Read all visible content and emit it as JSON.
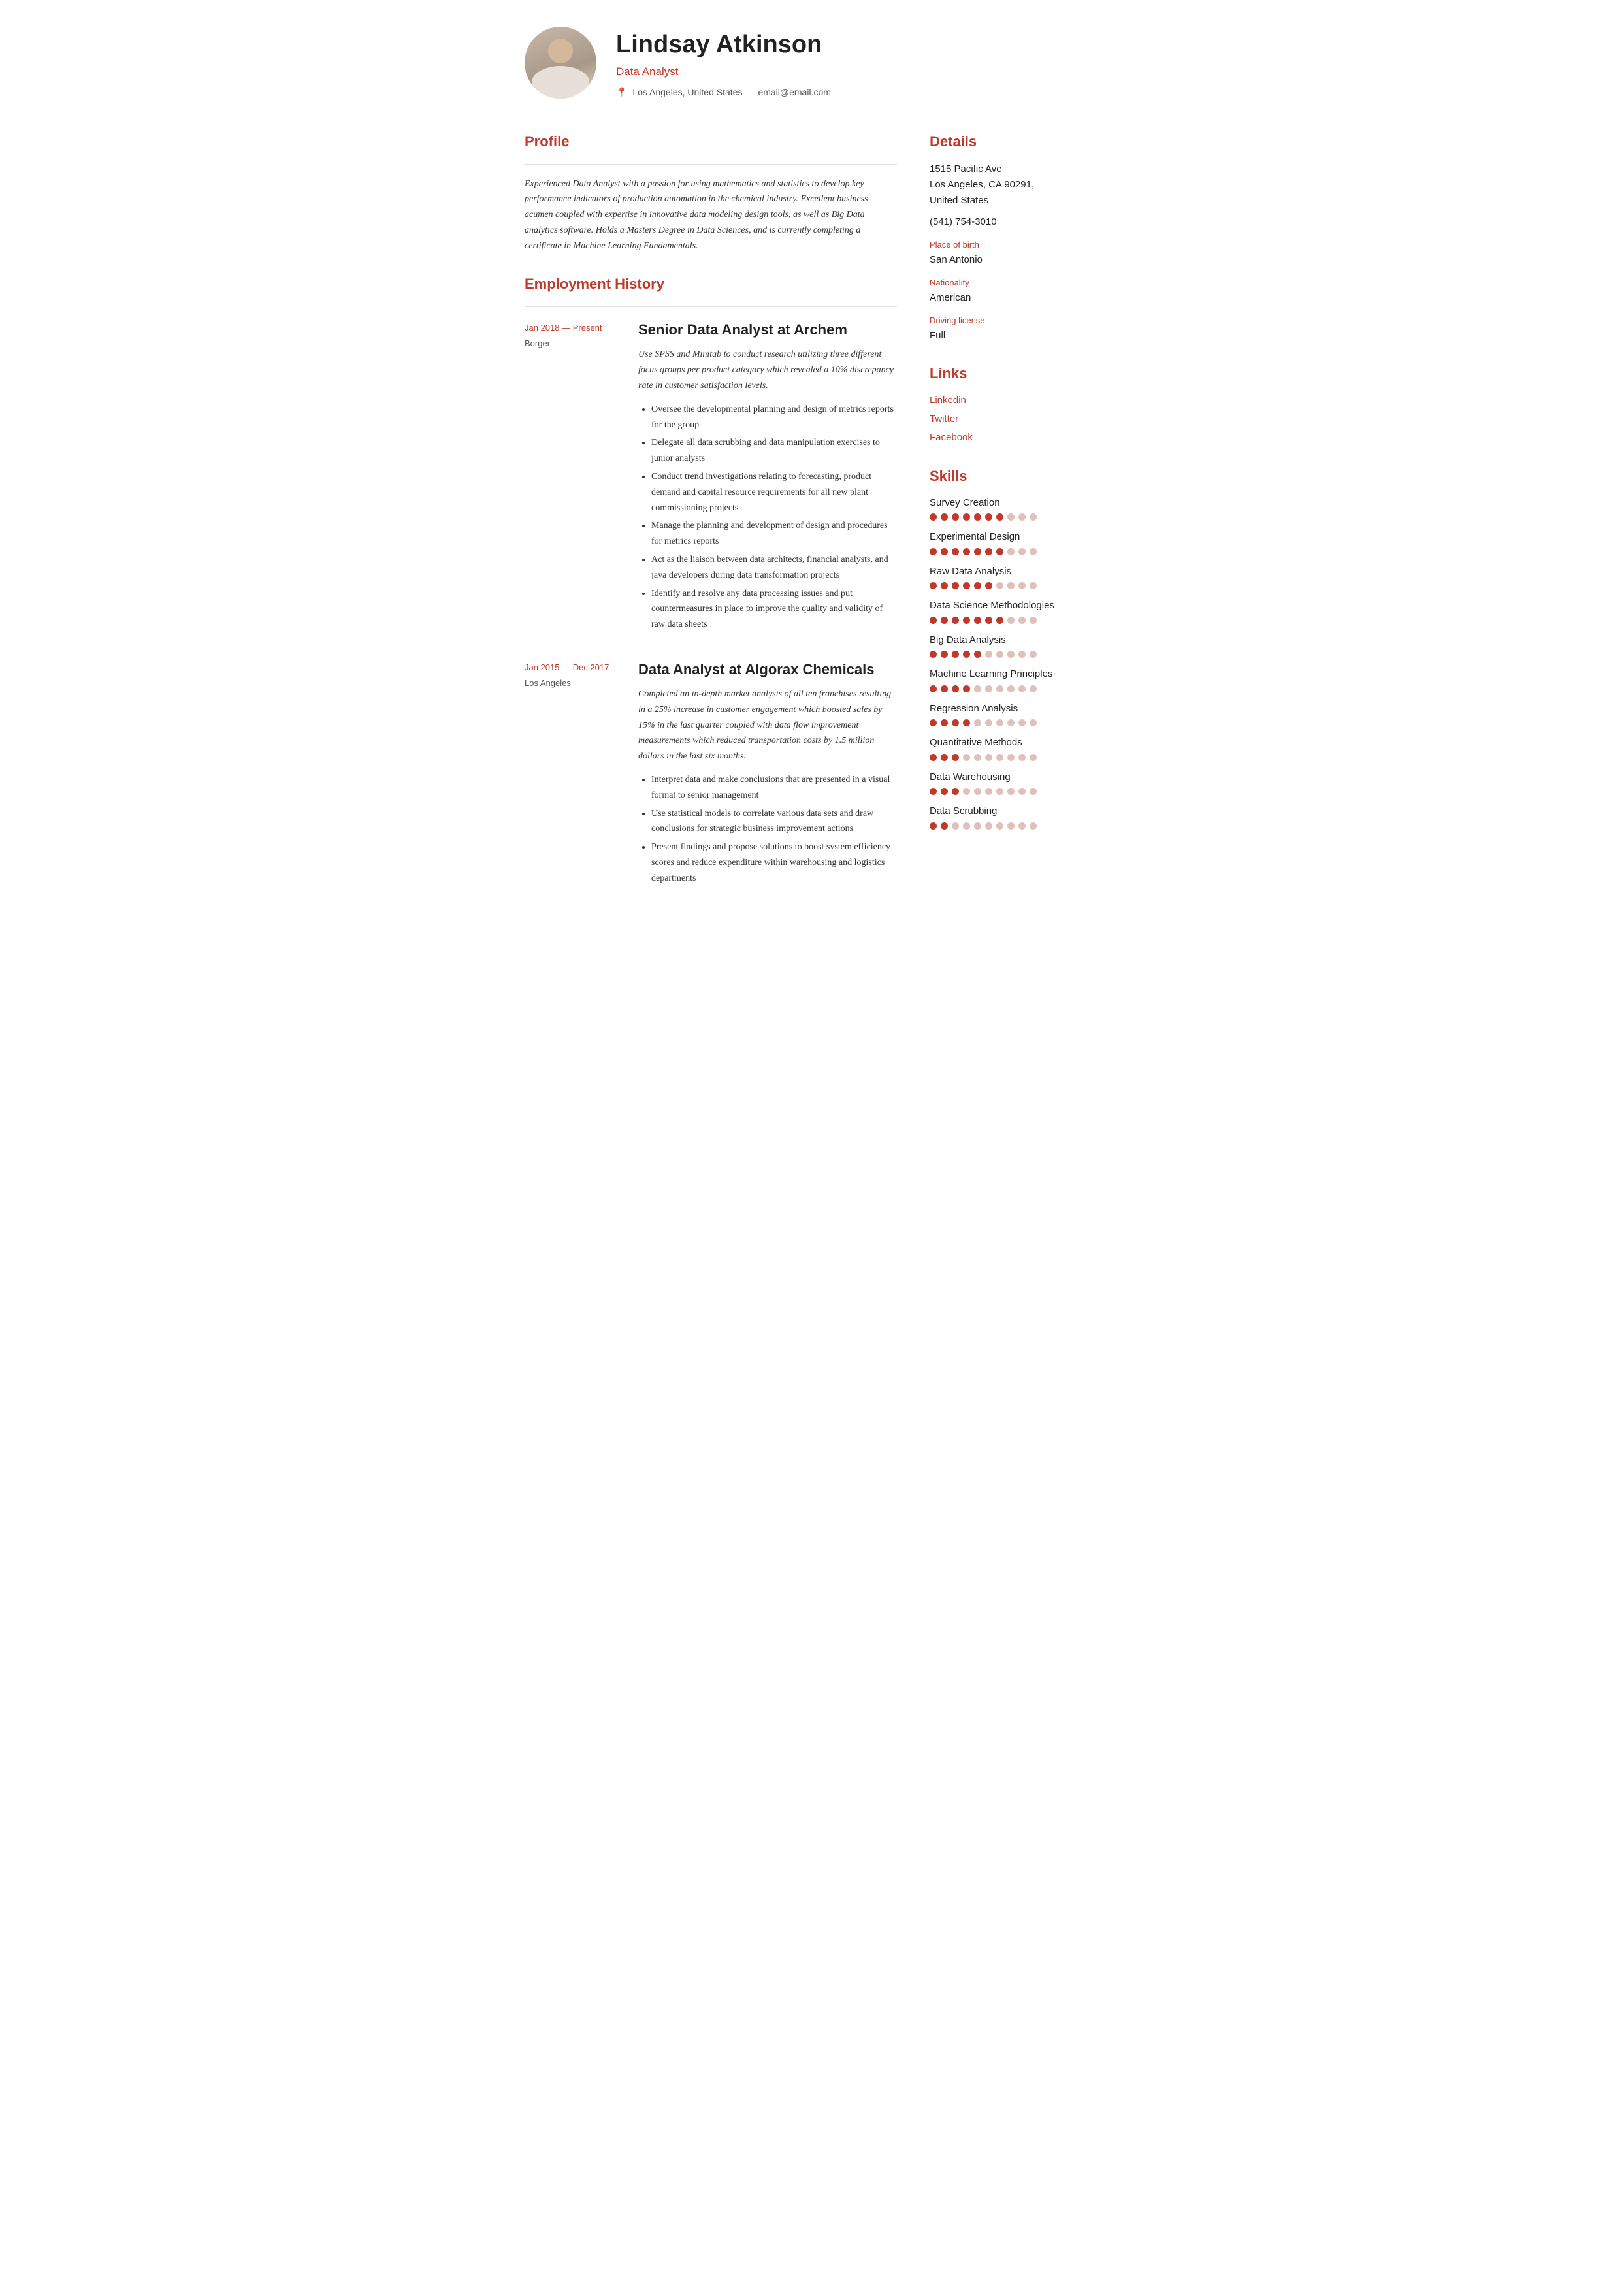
{
  "header": {
    "name": "Lindsay Atkinson",
    "title": "Data Analyst",
    "location": "Los Angeles, United States",
    "email": "email@email.com"
  },
  "profile": {
    "section_title": "Profile",
    "text": "Experienced Data Analyst with a passion for using mathematics and statistics to develop key performance indicators of production automation in the chemical industry.  Excellent business acumen coupled with expertise in innovative data modeling design tools, as well as Big Data analytics software.  Holds a Masters Degree in Data Sciences, and is currently completing a certificate in Machine Learning Fundamentals."
  },
  "employment": {
    "section_title": "Employment History",
    "jobs": [
      {
        "dates": "Jan 2018 — Present",
        "location": "Borger",
        "title": "Senior Data Analyst at  Archem",
        "summary": "Use SPSS and Minitab to conduct research utilizing three different focus groups per product category which revealed a 10% discrepancy rate in customer satisfaction levels.",
        "bullets": [
          "Oversee the developmental planning and design of metrics reports for the group",
          "Delegate all data scrubbing and data manipulation exercises to junior analysts",
          "Conduct trend investigations relating to forecasting, product demand and capital resource requirements for all new plant commissioning projects",
          "Manage the planning and development of design and procedures for metrics reports",
          "Act as the liaison between data architects, financial analysts, and java developers during data transformation projects",
          "Identify and resolve any data processing issues and put countermeasures in place to improve the quality and validity of raw data sheets"
        ]
      },
      {
        "dates": "Jan 2015 — Dec 2017",
        "location": "Los Angeles",
        "title": "Data Analyst at  Algorax Chemicals",
        "summary": "Completed an in-depth market analysis of all ten franchises resulting in a 25% increase in customer engagement which boosted sales by 15% in the last quarter coupled with data flow improvement measurements which reduced transportation costs by 1.5 million dollars in the last six months.",
        "bullets": [
          "Interpret data and make conclusions that are presented in a visual format to senior management",
          "Use statistical models to correlate various data sets and draw conclusions for strategic business improvement actions",
          "Present findings and propose solutions to boost system efficiency scores and reduce expenditure within warehousing and logistics departments"
        ]
      }
    ]
  },
  "details": {
    "section_title": "Details",
    "address1": "1515 Pacific Ave",
    "address2": "Los Angeles, CA 90291,",
    "address3": "United States",
    "phone": "(541) 754-3010",
    "place_of_birth_label": "Place of birth",
    "place_of_birth": "San Antonio",
    "nationality_label": "Nationality",
    "nationality": "American",
    "driving_license_label": "Driving license",
    "driving_license": "Full"
  },
  "links": {
    "section_title": "Links",
    "items": [
      {
        "label": "Linkedin"
      },
      {
        "label": "Twitter"
      },
      {
        "label": "Facebook"
      }
    ]
  },
  "skills": {
    "section_title": "Skills",
    "items": [
      {
        "name": "Survey Creation",
        "filled": 7,
        "total": 10
      },
      {
        "name": "Experimental Design",
        "filled": 7,
        "total": 10
      },
      {
        "name": "Raw Data Analysis",
        "filled": 6,
        "total": 10
      },
      {
        "name": "Data Science Methodologies",
        "filled": 7,
        "total": 10
      },
      {
        "name": "Big Data Analysis",
        "filled": 5,
        "total": 10
      },
      {
        "name": "Machine Learning Principles",
        "filled": 4,
        "total": 10
      },
      {
        "name": "Regression Analysis",
        "filled": 4,
        "total": 10
      },
      {
        "name": "Quantitative Methods",
        "filled": 3,
        "total": 10
      },
      {
        "name": "Data Warehousing",
        "filled": 3,
        "total": 10
      },
      {
        "name": "Data Scrubbing",
        "filled": 2,
        "total": 10
      }
    ]
  }
}
